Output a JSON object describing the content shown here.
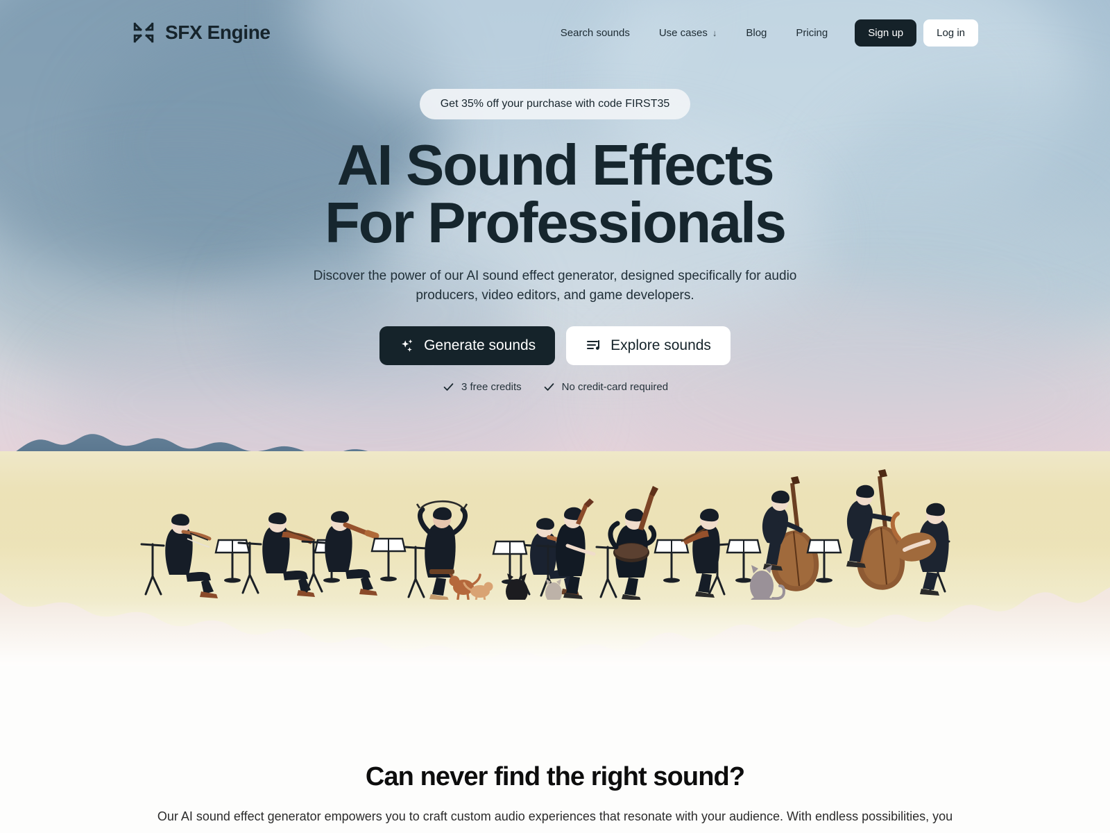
{
  "header": {
    "brand_name": "SFX Engine",
    "logo_icon": "collapse-arrows-icon",
    "nav": [
      {
        "label": "Search sounds",
        "icon": null
      },
      {
        "label": "Use cases",
        "icon": "chevron-down-icon",
        "caret": "↓"
      },
      {
        "label": "Blog",
        "icon": null
      },
      {
        "label": "Pricing",
        "icon": null
      }
    ],
    "signup_label": "Sign up",
    "login_label": "Log in"
  },
  "hero": {
    "promo": "Get 35% off your purchase with code FIRST35",
    "headline": "AI Sound Effects For Professionals",
    "subhead": "Discover the power of our AI sound effect generator, designed specifically for audio producers, video editors, and game developers.",
    "cta_primary": {
      "label": "Generate sounds",
      "icon": "sparkles-icon"
    },
    "cta_secondary": {
      "label": "Explore sounds",
      "icon": "playlist-music-icon"
    },
    "trust": [
      {
        "label": "3 free credits",
        "icon": "check-icon"
      },
      {
        "label": "No credit-card required",
        "icon": "check-icon"
      }
    ],
    "illustration": "orchestra-in-field-watercolor"
  },
  "section": {
    "title": "Can never find the right sound?",
    "body": "Our AI sound effect generator empowers you to craft custom audio experiences that resonate with your audience. With endless possibilities, you"
  },
  "colors": {
    "ink": "#15232a",
    "text": "#213039",
    "surface": "#ffffff",
    "promo_pill": "#f0f3f6",
    "sky_top": "#a8c1d3",
    "sky_bottom": "#f1e6d9",
    "treeline": "#55708a",
    "field": "#ede2bb",
    "page_bg": "#fdfdfc"
  }
}
